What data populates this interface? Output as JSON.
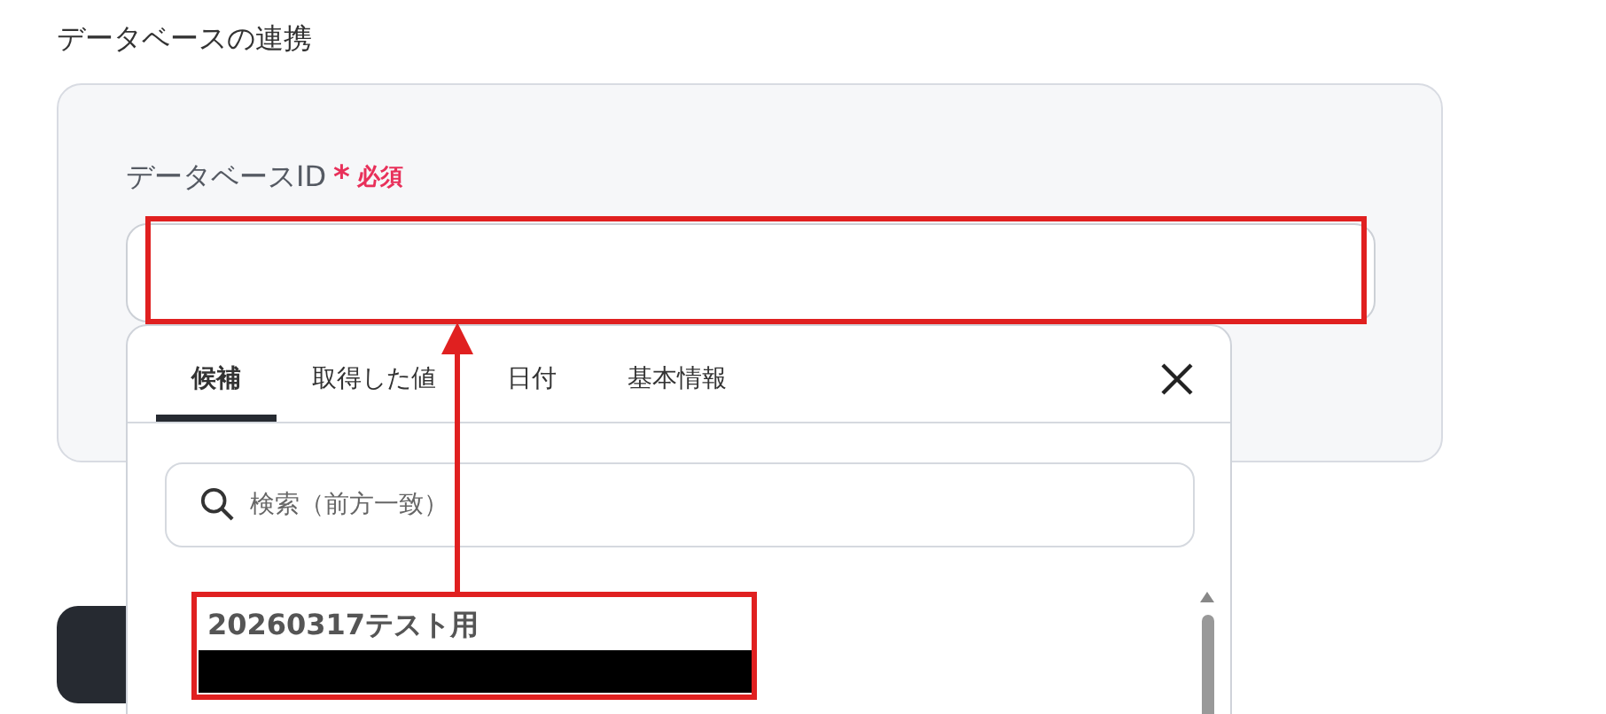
{
  "section_title": "データベースの連携",
  "field": {
    "label": "データベースID",
    "required_mark": "*",
    "required_text": "必須"
  },
  "dropdown": {
    "tabs": [
      {
        "label": "候補",
        "selected": true
      },
      {
        "label": "取得した値",
        "selected": false
      },
      {
        "label": "日付",
        "selected": false
      },
      {
        "label": "基本情報",
        "selected": false
      }
    ],
    "search": {
      "placeholder": "検索（前方一致）"
    },
    "options": [
      {
        "label": "20260317テスト用"
      }
    ]
  }
}
